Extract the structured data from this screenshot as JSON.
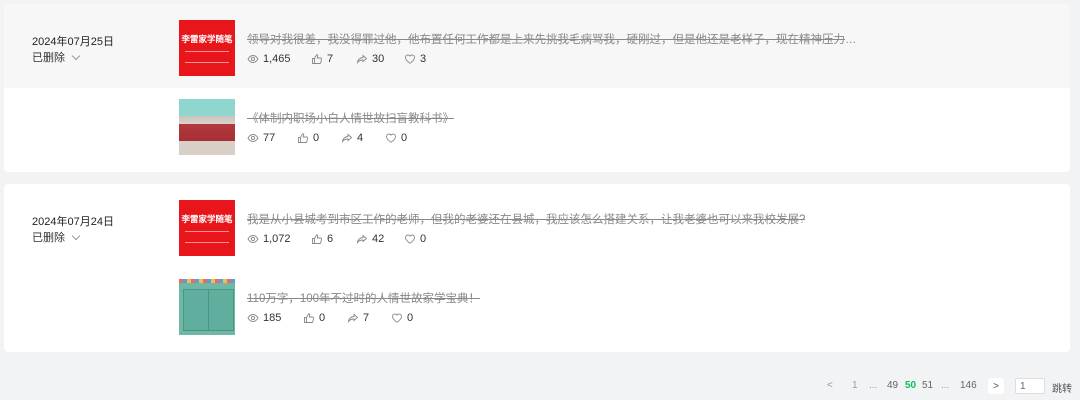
{
  "posts": [
    {
      "date": "2024年07月25日",
      "status": "已删除",
      "articles": [
        {
          "thumb_text": "李雷家学随笔",
          "title": "领导对我很差，我没得罪过他，他布置任何工作都是上来先挑我毛病骂我，硬刚过，但是他还是老样子，现在精神压力非常...",
          "views": "1,465",
          "likes": "7",
          "shares": "30",
          "favs": "3"
        },
        {
          "title": "《体制内职场小白人情世故扫盲教科书》",
          "views": "77",
          "likes": "0",
          "shares": "4",
          "favs": "0"
        }
      ]
    },
    {
      "date": "2024年07月24日",
      "status": "已删除",
      "articles": [
        {
          "thumb_text": "李雷家学随笔",
          "title": "我是从小县城考到市区工作的老师，但我的老婆还在县城，我应该怎么搭建关系，让我老婆也可以来我校发展?",
          "views": "1,072",
          "likes": "6",
          "shares": "42",
          "favs": "0"
        },
        {
          "title": "110万字，100年不过时的人情世故家学宝典！",
          "views": "185",
          "likes": "0",
          "shares": "7",
          "favs": "0"
        }
      ]
    }
  ],
  "pagination": {
    "prev": "<",
    "first": "1",
    "ellipsis1": "...",
    "p49": "49",
    "current": "50",
    "p51": "51",
    "ellipsis2": "...",
    "last": "146",
    "next": ">",
    "input_value": "1",
    "jump": "跳转",
    "current_color": "#07c160"
  },
  "icons": {
    "views": "eye-icon",
    "likes": "thumb-up-icon",
    "shares": "share-icon",
    "favs": "heart-icon"
  }
}
